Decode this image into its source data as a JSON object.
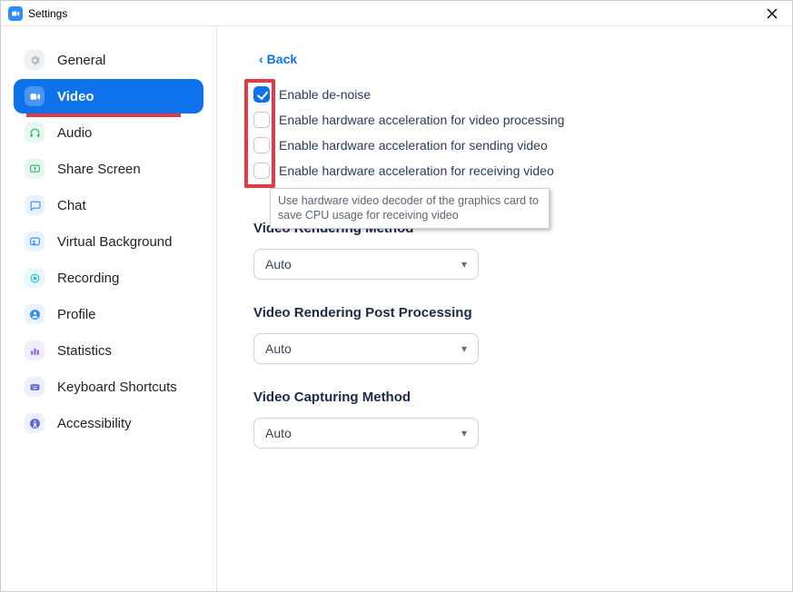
{
  "window": {
    "title": "Settings"
  },
  "sidebar": {
    "items": [
      {
        "key": "general",
        "label": "General"
      },
      {
        "key": "video",
        "label": "Video"
      },
      {
        "key": "audio",
        "label": "Audio"
      },
      {
        "key": "share-screen",
        "label": "Share Screen"
      },
      {
        "key": "chat",
        "label": "Chat"
      },
      {
        "key": "virtual-background",
        "label": "Virtual Background"
      },
      {
        "key": "recording",
        "label": "Recording"
      },
      {
        "key": "profile",
        "label": "Profile"
      },
      {
        "key": "statistics",
        "label": "Statistics"
      },
      {
        "key": "keyboard-shortcuts",
        "label": "Keyboard Shortcuts"
      },
      {
        "key": "accessibility",
        "label": "Accessibility"
      }
    ],
    "active_key": "video"
  },
  "main": {
    "back_label": "Back",
    "checks": [
      {
        "label": "Enable de-noise",
        "checked": true
      },
      {
        "label": "Enable hardware acceleration for video processing",
        "checked": false
      },
      {
        "label": "Enable hardware acceleration for sending video",
        "checked": false
      },
      {
        "label": "Enable hardware acceleration for receiving video",
        "checked": false
      }
    ],
    "tooltip": "Use hardware video decoder of the graphics card to save CPU usage for receiving video",
    "sections": [
      {
        "heading": "Video Rendering Method",
        "value": "Auto"
      },
      {
        "heading": "Video Rendering Post Processing",
        "value": "Auto"
      },
      {
        "heading": "Video Capturing Method",
        "value": "Auto"
      }
    ]
  },
  "annotation": {
    "red_box_on_checkboxes": true,
    "red_underline_on_active_nav": true
  }
}
